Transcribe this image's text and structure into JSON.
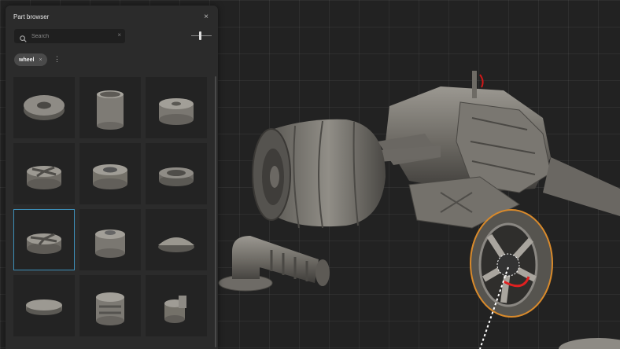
{
  "panel": {
    "title": "Part browser",
    "close_glyph": "×",
    "search": {
      "placeholder": "Search",
      "value": "",
      "icon": "search-icon",
      "clear_glyph": "×"
    },
    "filter_chip": {
      "label": "wheel",
      "remove_glyph": "×"
    },
    "more_glyph": "⋮",
    "tiles": [
      {
        "part": "tire"
      },
      {
        "part": "cylinder-can"
      },
      {
        "part": "hub-drum"
      },
      {
        "part": "five-spoke-rim"
      },
      {
        "part": "vented-rim"
      },
      {
        "part": "flat-dish-rim"
      },
      {
        "part": "five-spoke-rim-selected",
        "selected": true
      },
      {
        "part": "stepped-hub"
      },
      {
        "part": "dome-cap"
      },
      {
        "part": "flat-disc"
      },
      {
        "part": "slotted-drum"
      },
      {
        "part": "cap-with-knob"
      }
    ]
  },
  "colors": {
    "accent_selection": "#3d8fb8",
    "gizmo_orange": "#d98a2b",
    "gizmo_red": "#e02020"
  }
}
